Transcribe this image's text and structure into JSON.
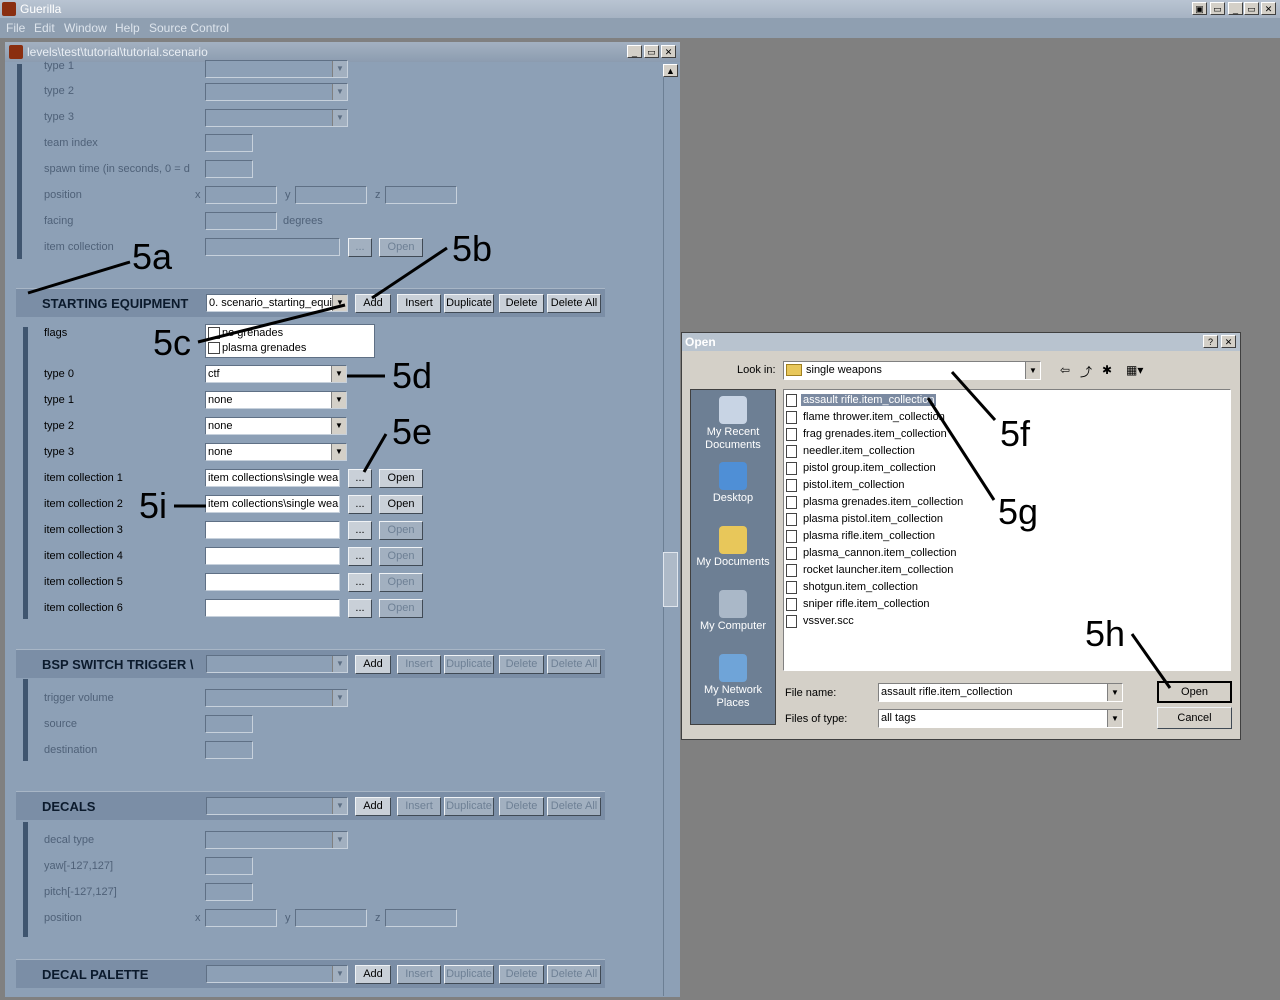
{
  "app": {
    "title": "Guerilla",
    "menu": [
      "File",
      "Edit",
      "Window",
      "Help",
      "Source Control"
    ]
  },
  "child_window": {
    "title": "levels\\test\\tutorial\\tutorial.scenario"
  },
  "top_fields": {
    "type1": "type 1",
    "type2": "type 2",
    "type3": "type 3",
    "team_index": "team index",
    "spawn_time": "spawn time (in seconds, 0 = d",
    "position": "position",
    "facing": "facing",
    "degrees": "degrees",
    "item_collection": "item collection",
    "x": "x",
    "y": "y",
    "z": "z",
    "dots": "...",
    "open": "Open"
  },
  "block_buttons": {
    "add": "Add",
    "insert": "Insert",
    "duplicate": "Duplicate",
    "delete": "Delete",
    "delete_all": "Delete All"
  },
  "starting_equipment": {
    "title": "STARTING EQUIPMENT",
    "selector": "0. scenario_starting_equip",
    "flags_label": "flags",
    "flags": [
      "no grenades",
      "plasma grenades"
    ],
    "type0": {
      "label": "type 0",
      "value": "ctf"
    },
    "type1": {
      "label": "type 1",
      "value": "none"
    },
    "type2": {
      "label": "type 2",
      "value": "none"
    },
    "type3": {
      "label": "type 3",
      "value": "none"
    },
    "collections": [
      {
        "label": "item collection 1",
        "value": "item collections\\single wea"
      },
      {
        "label": "item collection 2",
        "value": "item collections\\single wea"
      },
      {
        "label": "item collection 3",
        "value": ""
      },
      {
        "label": "item collection 4",
        "value": ""
      },
      {
        "label": "item collection 5",
        "value": ""
      },
      {
        "label": "item collection 6",
        "value": ""
      }
    ]
  },
  "bsp_switch": {
    "title": "BSP SWITCH TRIGGER \\",
    "trigger_volume": "trigger volume",
    "source": "source",
    "destination": "destination"
  },
  "decals": {
    "title": "DECALS",
    "decal_type": "decal type",
    "yaw": "yaw[-127,127]",
    "pitch": "pitch[-127,127]",
    "position": "position"
  },
  "decal_palette": {
    "title": "DECAL PALETTE"
  },
  "annotations": [
    "5a",
    "5b",
    "5c",
    "5d",
    "5e",
    "5f",
    "5g",
    "5h",
    "5i"
  ],
  "dialog": {
    "title": "Open",
    "help": "?",
    "close": "✕",
    "look_in_label": "Look in:",
    "look_in_value": "single weapons",
    "places": [
      "My Recent Documents",
      "Desktop",
      "My Documents",
      "My Computer",
      "My Network Places"
    ],
    "files": [
      "assault rifle.item_collection",
      "flame thrower.item_collection",
      "frag grenades.item_collection",
      "needler.item_collection",
      "pistol group.item_collection",
      "pistol.item_collection",
      "plasma grenades.item_collection",
      "plasma pistol.item_collection",
      "plasma rifle.item_collection",
      "plasma_cannon.item_collection",
      "rocket launcher.item_collection",
      "shotgun.item_collection",
      "sniper rifle.item_collection",
      "vssver.scc"
    ],
    "selected_index": 0,
    "file_name_label": "File name:",
    "file_name_value": "assault rifle.item_collection",
    "files_of_type_label": "Files of type:",
    "files_of_type_value": "all tags",
    "open_button": "Open",
    "cancel_button": "Cancel"
  },
  "colors": {
    "panel": "#8da0b6",
    "header": "#7b8ea6",
    "dialog": "#d4d0c8",
    "selection": "#7b8aa1"
  }
}
